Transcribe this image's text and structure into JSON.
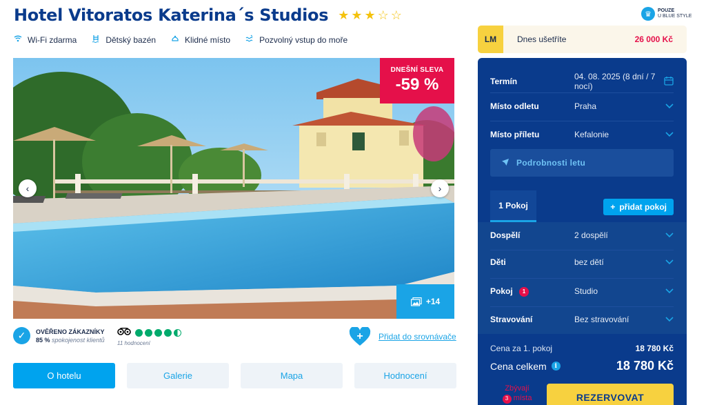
{
  "hotel": {
    "name": "Hotel Vitoratos Katerina´s Studios",
    "stars_full": 3,
    "stars_total": 5
  },
  "blue_style": {
    "line1": "POUZE",
    "line2": "U BLUE STYLE",
    "icon": "crown-icon"
  },
  "amenities": [
    {
      "label": "Wi-Fi zdarma",
      "icon": "wifi-icon"
    },
    {
      "label": "Dětský bazén",
      "icon": "child-pool-icon"
    },
    {
      "label": "Klidné místo",
      "icon": "quiet-place-icon"
    },
    {
      "label": "Pozvolný vstup do moře",
      "icon": "sea-entry-icon"
    }
  ],
  "gallery": {
    "sale_label": "DNEŠNÍ SLEVA",
    "sale_value": "-59 %",
    "photo_count": "+14"
  },
  "verified": {
    "title": "OVĚŘENO ZÁKAZNÍKY",
    "percent": "85 %",
    "percent_note": "spokojenost klientů"
  },
  "tripadvisor": {
    "rating": 4.5,
    "count_text": "11 hodnocení"
  },
  "compare": {
    "label": "Přidat do srovnávače"
  },
  "tabs": [
    {
      "label": "O hotelu",
      "active": true
    },
    {
      "label": "Galerie",
      "active": false
    },
    {
      "label": "Mapa",
      "active": false
    },
    {
      "label": "Hodnocení",
      "active": false
    }
  ],
  "savings": {
    "badge": "LM",
    "label": "Dnes ušetříte",
    "amount": "26 000 Kč"
  },
  "booking": {
    "term_label": "Termín",
    "term_value": "04. 08. 2025 (8 dní / 7 nocí)",
    "departure_label": "Místo odletu",
    "departure_value": "Praha",
    "arrival_label": "Místo příletu",
    "arrival_value": "Kefalonie",
    "flight_details": "Podrobnosti letu",
    "room_tab": "1 Pokoj",
    "add_room": "přidat pokoj",
    "adults_label": "Dospělí",
    "adults_value": "2 dospělí",
    "children_label": "Děti",
    "children_value": "bez dětí",
    "room_label": "Pokoj",
    "room_badge": "1",
    "room_value": "Studio",
    "board_label": "Stravování",
    "board_value": "Bez stravování",
    "price_room_label": "Cena za 1. pokoj",
    "price_room_value": "18 780 Kč",
    "price_total_label": "Cena celkem",
    "price_total_value": "18 780 Kč",
    "remaining_line1": "Zbývají",
    "remaining_num": "3",
    "remaining_line2": "místa",
    "reserve_label": "REZERVOVAT"
  },
  "colors": {
    "brand_dark": "#0a3b8c",
    "accent_blue": "#1aa4e6",
    "sale_red": "#e5104a",
    "cta_yellow": "#f7d13f"
  }
}
